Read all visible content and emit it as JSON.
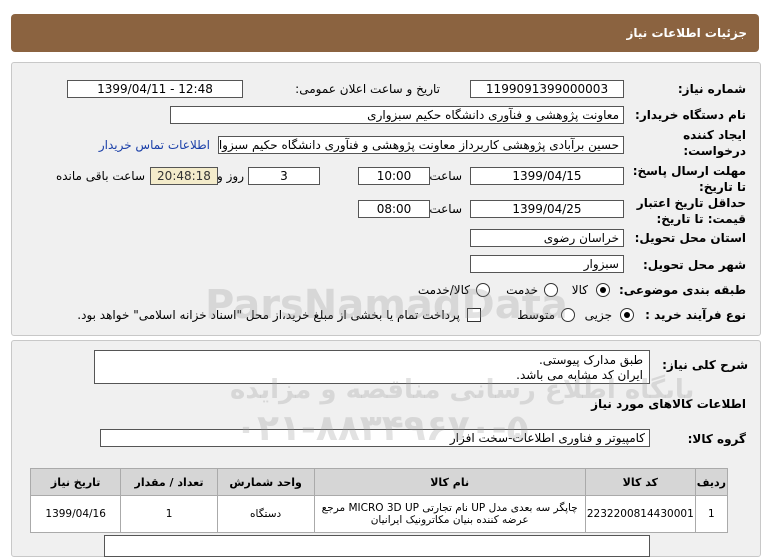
{
  "header": {
    "title": "جزئیات اطلاعات نیاز"
  },
  "fields": {
    "need_number_label": "شماره نیاز:",
    "need_number": "1199091399000003",
    "announce_label": "تاریخ و ساعت اعلان عمومی:",
    "announce_value": "1399/04/11 - 12:48",
    "buyer_label": "نام دستگاه خریدار:",
    "buyer_value": "معاونت پژوهشی و فنآوری دانشگاه حکیم سبزواری",
    "creator_label_1": "ایجاد کننده",
    "creator_label_2": "درخواست:",
    "creator_value": "حسین برآبادی پژوهشی کاربرداز معاونت پژوهشی و فنآوری دانشگاه حکیم سبزواری",
    "contact_link": "اطلاعات تماس خریدار",
    "reply_label_1": "مهلت ارسال پاسخ:",
    "reply_label_2": "تا تاریخ:",
    "reply_date": "1399/04/15",
    "time_label": "ساعت",
    "reply_time": "10:00",
    "days_value": "3",
    "days_label": "روز و",
    "remaining_time": "20:48:18",
    "remaining_label": "ساعت باقی مانده",
    "validity_label_1": "حداقل تاریخ اعتبار",
    "validity_label_2": "قیمت: تا تاریخ:",
    "validity_date": "1399/04/25",
    "validity_time_label": "ساعت",
    "validity_time": "08:00",
    "province_label": "استان محل تحویل:",
    "province_value": "خراسان رضوی",
    "city_label": "شهر محل تحویل:",
    "city_value": "سبزوار",
    "category_label": "طبقه بندی موضوعی:",
    "category_options": [
      "کالا",
      "خدمت",
      "کالا/خدمت"
    ],
    "process_label": "نوع فرآیند خرید :",
    "process_options": [
      "جزیی",
      "متوسط"
    ],
    "payment_text": "پرداخت تمام یا بخشی از مبلغ خرید،از محل \"اسناد خزانه اسلامی\" خواهد بود."
  },
  "description": {
    "label": "شرح کلی نیاز:",
    "line1": "طبق مدارک پیوستی.",
    "line2": "ایران کد مشابه می باشد."
  },
  "goods": {
    "section_title": "اطلاعات کالاهای مورد نیاز",
    "group_label": "گروه کالا:",
    "group_value": "کامپیوتر و فناوری اطلاعات-سخت افزار",
    "columns": [
      "ردیف",
      "کد کالا",
      "نام کالا",
      "واحد شمارش",
      "تعداد / مقدار",
      "تاریخ نیاز"
    ],
    "rows": [
      {
        "row": "1",
        "code": "2232200814430001",
        "name_line1": "چاپگر سه بعدی مدل UP نام تجارتی MICRO 3D UP مرجع",
        "name_line2": "عرضه کننده بنیان مکاترونیک ایرانیان",
        "unit": "دستگاه",
        "qty": "1",
        "date": "1399/04/16"
      }
    ]
  },
  "watermark": {
    "brand": "ParsNamadData",
    "line_fa": "پایگاه اطلاع رسانی مناقصه و مزایده",
    "phone": "۰۲۱-۸۸۳۴۹۶۷۰-۵"
  }
}
